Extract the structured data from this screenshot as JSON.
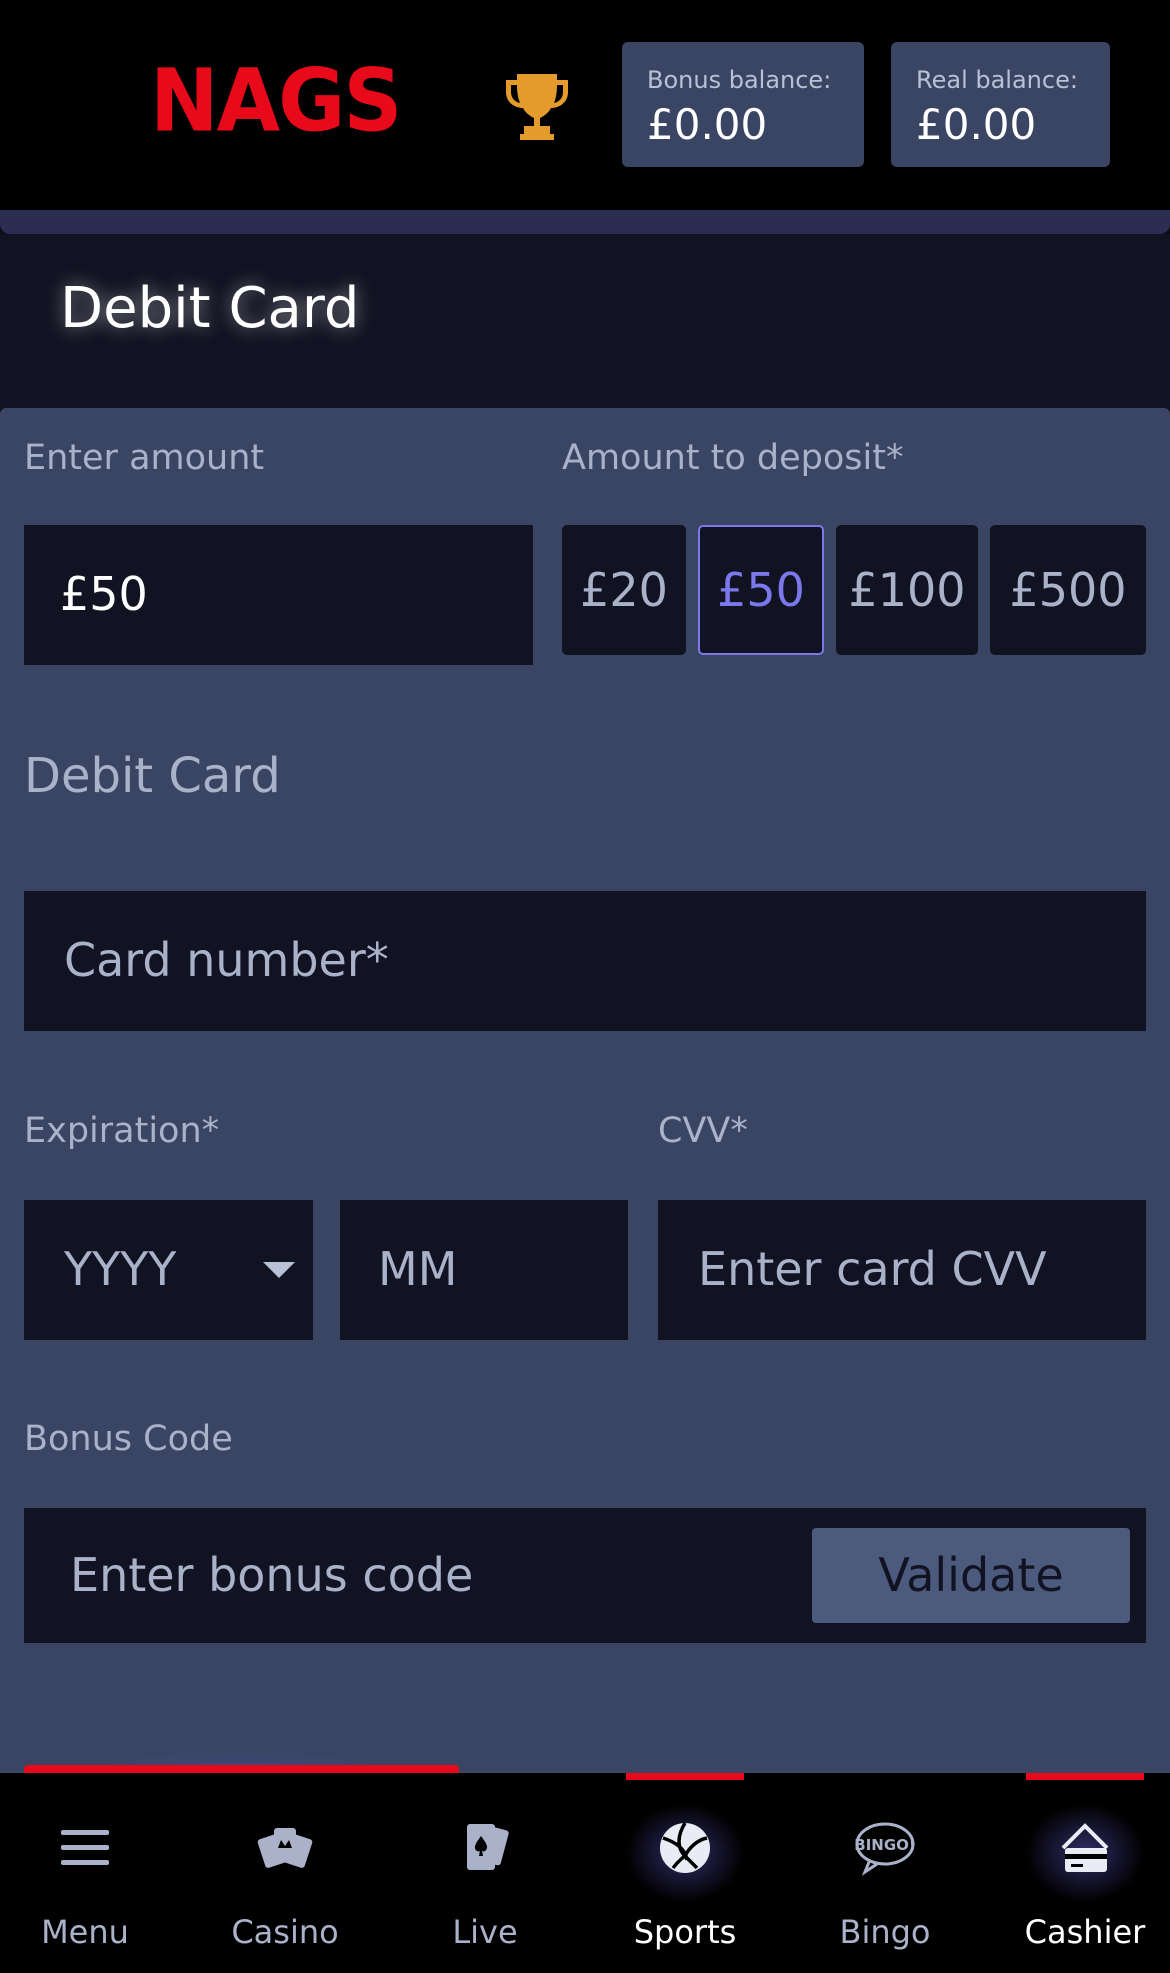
{
  "header": {
    "logo_text": "NAGS",
    "trophy_icon": "trophy-icon",
    "bonus_balance_label": "Bonus balance:",
    "bonus_balance_value": "£0.00",
    "real_balance_label": "Real balance:",
    "real_balance_value": "£0.00"
  },
  "page": {
    "title": "Debit Card"
  },
  "form": {
    "enter_amount_label": "Enter amount",
    "amount_value": "£50",
    "deposit_label": "Amount to deposit*",
    "quick_amounts": [
      "£20",
      "£50",
      "£100",
      "£500"
    ],
    "selected_amount": "£50",
    "section_title": "Debit Card",
    "card_number_placeholder": "Card number*",
    "expiration_label": "Expiration*",
    "year_placeholder": "YYYY",
    "month_placeholder": "MM",
    "cvv_label": "CVV*",
    "cvv_placeholder": "Enter card CVV",
    "bonus_label": "Bonus Code",
    "bonus_placeholder": "Enter bonus code",
    "validate_label": "Validate"
  },
  "nav": {
    "items": [
      {
        "label": "Menu",
        "icon": "menu-icon"
      },
      {
        "label": "Casino",
        "icon": "casino-icon"
      },
      {
        "label": "Live",
        "icon": "live-cards-icon"
      },
      {
        "label": "Sports",
        "icon": "sports-ball-icon"
      },
      {
        "label": "Bingo",
        "icon": "bingo-icon"
      },
      {
        "label": "Cashier",
        "icon": "cashier-icon"
      }
    ],
    "active": [
      "Sports",
      "Cashier"
    ]
  },
  "colors": {
    "accent_red": "#e8091a",
    "selected_purple": "#7b78ec",
    "panel": "#3a4564",
    "field": "#111322"
  }
}
